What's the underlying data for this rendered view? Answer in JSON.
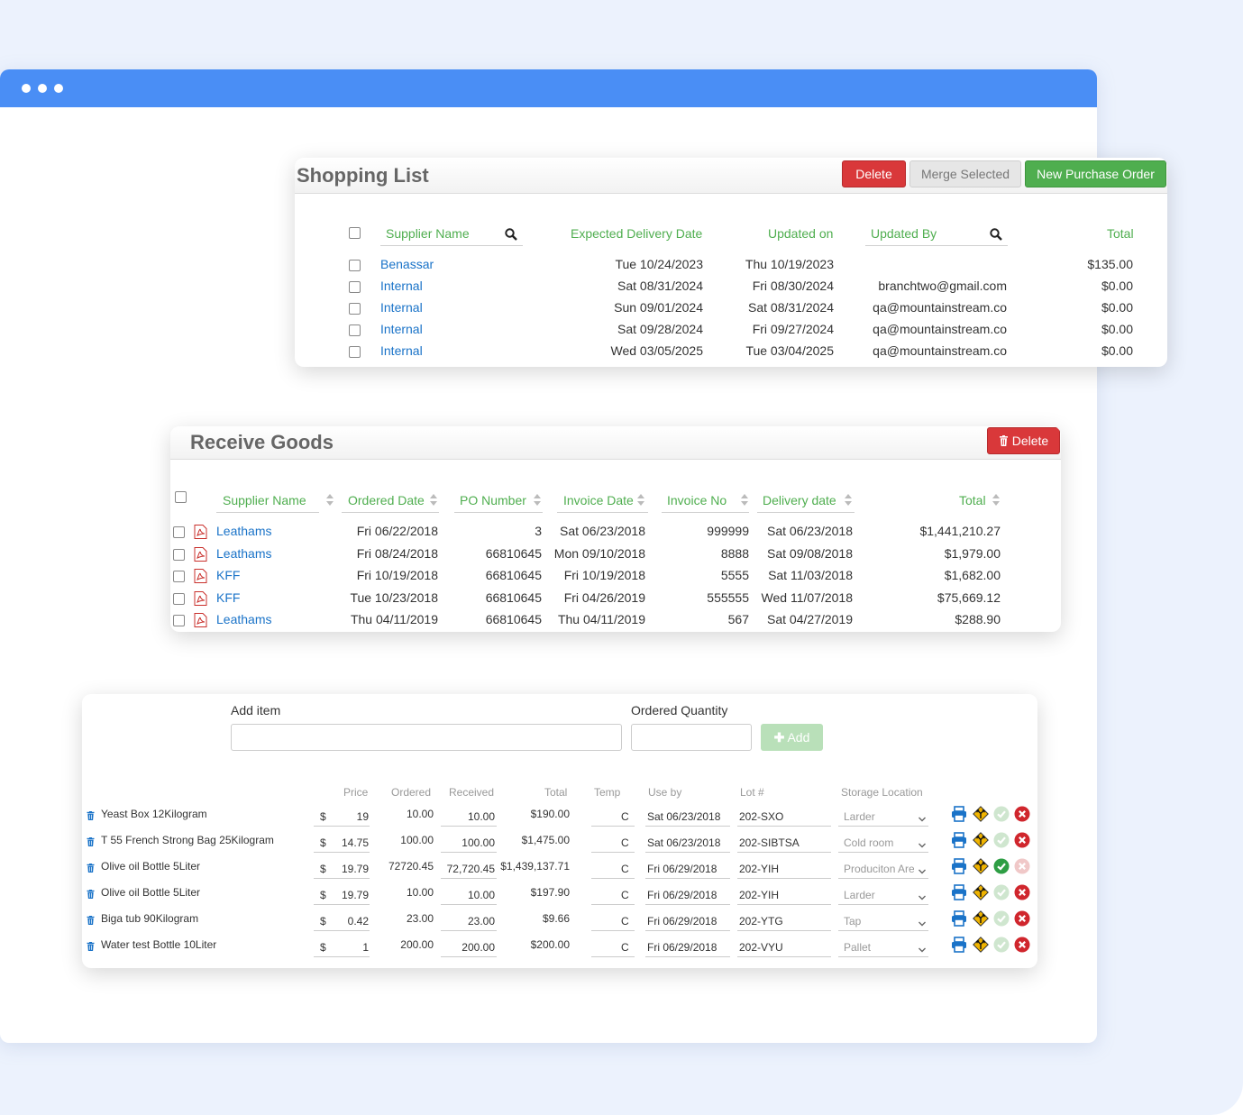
{
  "shopping_list": {
    "title": "Shopping List",
    "buttons": {
      "delete": "Delete",
      "merge": "Merge Selected",
      "new_po": "New Purchase Order"
    },
    "columns": {
      "supplier": "Supplier Name",
      "expected": "Expected Delivery Date",
      "updated_on": "Updated on",
      "updated_by": "Updated By",
      "total": "Total"
    },
    "rows": [
      {
        "supplier": "Benassar",
        "expected": "Tue 10/24/2023",
        "updated_on": "Thu 10/19/2023",
        "updated_by": "",
        "total": "$135.00"
      },
      {
        "supplier": "Internal",
        "expected": "Sat 08/31/2024",
        "updated_on": "Fri 08/30/2024",
        "updated_by": "branchtwo@gmail.com",
        "total": "$0.00"
      },
      {
        "supplier": "Internal",
        "expected": "Sun 09/01/2024",
        "updated_on": "Sat 08/31/2024",
        "updated_by": "qa@mountainstream.co",
        "total": "$0.00"
      },
      {
        "supplier": "Internal",
        "expected": "Sat 09/28/2024",
        "updated_on": "Fri 09/27/2024",
        "updated_by": "qa@mountainstream.co",
        "total": "$0.00"
      },
      {
        "supplier": "Internal",
        "expected": "Wed 03/05/2025",
        "updated_on": "Tue 03/04/2025",
        "updated_by": "qa@mountainstream.co",
        "total": "$0.00"
      }
    ]
  },
  "receive_goods": {
    "title": "Receive Goods",
    "delete_label": "Delete",
    "columns": {
      "supplier": "Supplier Name",
      "ordered": "Ordered Date",
      "po": "PO Number",
      "invoice_date": "Invoice Date",
      "invoice_no": "Invoice No",
      "delivery": "Delivery date",
      "total": "Total"
    },
    "rows": [
      {
        "supplier": "Leathams",
        "ordered": "Fri 06/22/2018",
        "po": "3",
        "invoice_date": "Sat 06/23/2018",
        "invoice_no": "999999",
        "delivery": "Sat 06/23/2018",
        "total": "$1,441,210.27"
      },
      {
        "supplier": "Leathams",
        "ordered": "Fri 08/24/2018",
        "po": "66810645",
        "invoice_date": "Mon 09/10/2018",
        "invoice_no": "8888",
        "delivery": "Sat 09/08/2018",
        "total": "$1,979.00"
      },
      {
        "supplier": "KFF",
        "ordered": "Fri 10/19/2018",
        "po": "66810645",
        "invoice_date": "Fri 10/19/2018",
        "invoice_no": "5555",
        "delivery": "Sat 11/03/2018",
        "total": "$1,682.00"
      },
      {
        "supplier": "KFF",
        "ordered": "Tue 10/23/2018",
        "po": "66810645",
        "invoice_date": "Fri 04/26/2019",
        "invoice_no": "555555",
        "delivery": "Wed 11/07/2018",
        "total": "$75,669.12"
      },
      {
        "supplier": "Leathams",
        "ordered": "Thu 04/11/2019",
        "po": "66810645",
        "invoice_date": "Thu 04/11/2019",
        "invoice_no": "567",
        "delivery": "Sat 04/27/2019",
        "total": "$288.90"
      }
    ]
  },
  "items": {
    "add_item_label": "Add item",
    "ordered_qty_label": "Ordered Quantity",
    "add_button": "Add",
    "columns": {
      "price": "Price",
      "ordered": "Ordered",
      "received": "Received",
      "total": "Total",
      "temp": "Temp",
      "use_by": "Use by",
      "lot": "Lot #",
      "storage": "Storage Location"
    },
    "currency": "$",
    "rows": [
      {
        "name": "Yeast Box 12Kilogram",
        "price": "19",
        "ordered": "10.00",
        "received": "10.00",
        "total": "$190.00",
        "temp": "C",
        "use_by": "Sat 06/23/2018",
        "lot": "202-SXO",
        "storage": "Larder",
        "checked": false
      },
      {
        "name": "T 55 French Strong Bag 25Kilogram",
        "price": "14.75",
        "ordered": "100.00",
        "received": "100.00",
        "total": "$1,475.00",
        "temp": "C",
        "use_by": "Sat 06/23/2018",
        "lot": "202-SIBTSA",
        "storage": "Cold room",
        "checked": false
      },
      {
        "name": "Olive oil Bottle 5Liter",
        "price": "19.79",
        "ordered": "72720.45",
        "received": "72,720.45",
        "total": "$1,439,137.71",
        "temp": "C",
        "use_by": "Fri 06/29/2018",
        "lot": "202-YIH",
        "storage": "Produciton Area",
        "checked": true
      },
      {
        "name": "Olive oil Bottle 5Liter",
        "price": "19.79",
        "ordered": "10.00",
        "received": "10.00",
        "total": "$197.90",
        "temp": "C",
        "use_by": "Fri 06/29/2018",
        "lot": "202-YIH",
        "storage": "Larder",
        "checked": false
      },
      {
        "name": "Biga tub 90Kilogram",
        "price": "0.42",
        "ordered": "23.00",
        "received": "23.00",
        "total": "$9.66",
        "temp": "C",
        "use_by": "Fri 06/29/2018",
        "lot": "202-YTG",
        "storage": "Tap",
        "checked": false
      },
      {
        "name": "Water test Bottle 10Liter",
        "price": "1",
        "ordered": "200.00",
        "received": "200.00",
        "total": "$200.00",
        "temp": "C",
        "use_by": "Fri 06/29/2018",
        "lot": "202-VYU",
        "storage": "Pallet",
        "checked": false
      }
    ]
  },
  "colors": {
    "titlebar": "#4a8ef5",
    "header_green": "#4fae4f",
    "link_blue": "#1a73c8",
    "danger": "#d9383a"
  }
}
